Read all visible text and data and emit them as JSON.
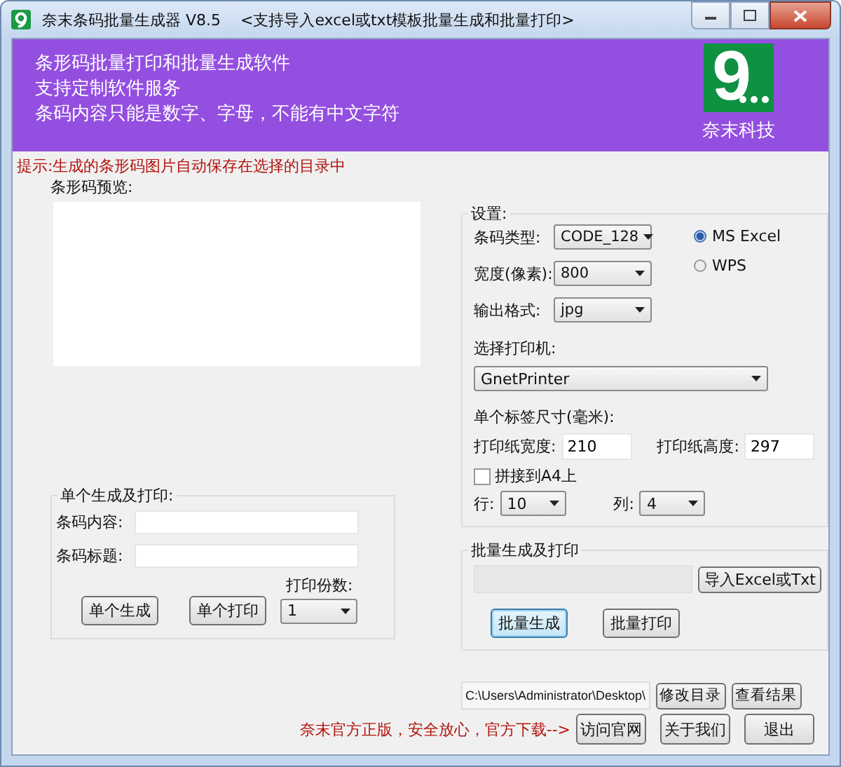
{
  "window": {
    "title": "奈末条码批量生成器 V8.5",
    "subtitle": "<支持导入excel或txt模板批量生成和批量打印>"
  },
  "banner": {
    "lines": [
      "条形码批量打印和批量生成软件",
      "支持定制软件服务",
      "条码内容只能是数字、字母，不能有中文字符"
    ],
    "logo_text": "9",
    "company": "奈末科技"
  },
  "hint": "提示:生成的条形码图片自动保存在选择的目录中",
  "preview": {
    "label": "条形码预览:"
  },
  "single": {
    "title": "单个生成及打印:",
    "fields": [
      {
        "label": "条码内容:"
      },
      {
        "label": "条码标题:"
      }
    ],
    "copies_label": "打印份数:",
    "copies": "1",
    "buttons": [
      "单个生成",
      "单个打印"
    ]
  },
  "settings": {
    "title": "设置:",
    "rows": [
      {
        "label": "条码类型:",
        "value": "CODE_128"
      },
      {
        "label": "宽度(像素):",
        "value": "800"
      },
      {
        "label": "输出格式:",
        "value": "jpg"
      }
    ],
    "radios": [
      {
        "label": "MS  Excel",
        "selected": true
      },
      {
        "label": "WPS",
        "selected": false
      }
    ],
    "printer_label": "选择打印机:",
    "printer": "GnetPrinter",
    "size_label": "单个标签尺寸(毫米):",
    "paper": [
      {
        "label": "打印纸宽度:",
        "value": "210"
      },
      {
        "label": "打印纸高度:",
        "value": "297"
      }
    ],
    "tile": {
      "label": "拼接到A4上",
      "checked": false
    },
    "grid": [
      {
        "label": "行:",
        "value": "10"
      },
      {
        "label": "列:",
        "value": "4"
      }
    ]
  },
  "batch": {
    "title": "批量生成及打印",
    "import_button": "导入Excel或Txt",
    "buttons": [
      {
        "label": "批量生成",
        "focused": true
      },
      {
        "label": "批量打印",
        "focused": false
      }
    ]
  },
  "output": {
    "path": "C:\\Users\\Administrator\\Desktop\\",
    "buttons": [
      "修改目录",
      "查看结果"
    ]
  },
  "footer": {
    "notice": "奈末官方正版，安全放心，官方下载-->",
    "buttons": [
      "访问官网",
      "关于我们",
      "退出"
    ]
  }
}
